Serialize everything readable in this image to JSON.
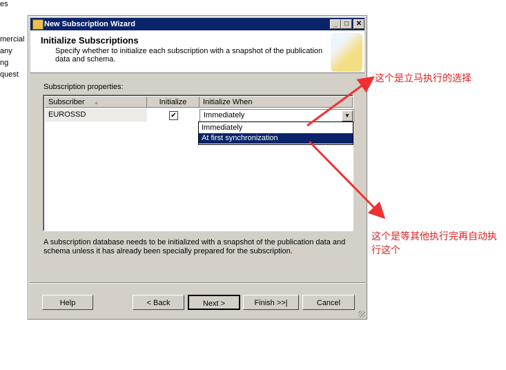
{
  "background_fragments": [
    "es",
    "mercial",
    "any",
    "ng",
    "quest"
  ],
  "window": {
    "title": "New Subscription Wizard",
    "buttons": [
      "_",
      "□",
      "✕"
    ]
  },
  "header": {
    "title": "Initialize Subscriptions",
    "description": "Specify whether to initialize each subscription with a snapshot of the publication data and schema."
  },
  "grid": {
    "label": "Subscription properties:",
    "columns": [
      "Subscriber",
      "Initialize",
      "Initialize When"
    ],
    "sort_indicator": "▲",
    "rows": [
      {
        "subscriber": "EUROSSD",
        "initialize": true,
        "initialize_when": "Immediately"
      }
    ]
  },
  "dropdown": {
    "options": [
      "Immediately",
      "At first synchronization"
    ],
    "highlighted": "At first synchronization"
  },
  "info_text": "A subscription database needs to be initialized with a snapshot of the publication data and schema unless it has already been specially prepared for the subscription.",
  "buttons": {
    "help": "Help",
    "back": "< Back",
    "next": "Next >",
    "finish": "Finish >>|",
    "cancel": "Cancel"
  },
  "annotations": {
    "top": "这个是立马执行的选择",
    "bottom": "这个是等其他执行完再自动执行这个",
    "color": "#e02020"
  }
}
